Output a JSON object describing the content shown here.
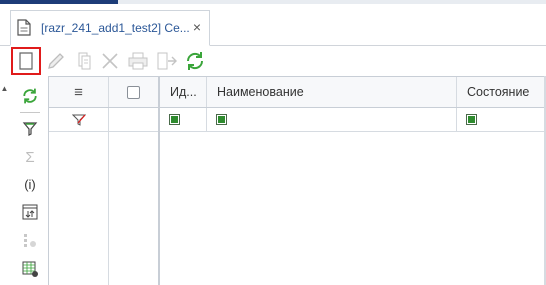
{
  "tab": {
    "title": "[razr_241_add1_test2] Се...",
    "close_label": "×"
  },
  "toolbar": {
    "buttons": [
      {
        "name": "new-document-icon",
        "enabled": true,
        "highlighted": true
      },
      {
        "name": "edit-pencil-icon",
        "enabled": false
      },
      {
        "name": "copy-icon",
        "enabled": false
      },
      {
        "name": "delete-x-icon",
        "enabled": false
      },
      {
        "name": "print-icon",
        "enabled": false
      },
      {
        "name": "export-icon",
        "enabled": false
      },
      {
        "name": "refresh-icon",
        "enabled": true
      }
    ]
  },
  "sidebar": {
    "collapse_arrow": "▲",
    "buttons": [
      {
        "name": "refresh-icon",
        "enabled": true
      },
      {
        "name": "filter-funnel-icon",
        "enabled": true
      },
      {
        "name": "sum-icon",
        "enabled": false,
        "glyph": "Σ"
      },
      {
        "name": "info-icon",
        "enabled": true,
        "glyph": "(i)"
      },
      {
        "name": "sort-icon",
        "enabled": true
      },
      {
        "name": "tree-icon",
        "enabled": false
      },
      {
        "name": "table-settings-icon",
        "enabled": true
      }
    ]
  },
  "grid": {
    "menu_glyph": "≡",
    "columns": [
      {
        "label": "Ид..."
      },
      {
        "label": "Наименование"
      },
      {
        "label": "Состояние"
      }
    ]
  },
  "colors": {
    "accent_bar": "#1d3c78",
    "tab_title": "#2b5797",
    "highlight_border": "#e01b1b",
    "refresh_green": "#3aa53a",
    "filter_fill": "#2e8b2e"
  }
}
